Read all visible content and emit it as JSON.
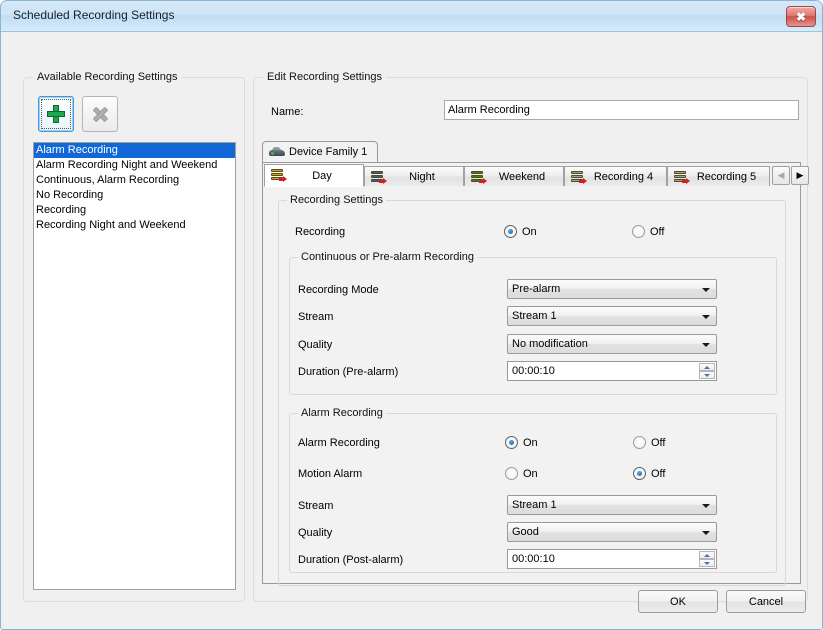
{
  "window": {
    "title": "Scheduled Recording Settings",
    "close_label": "✖"
  },
  "left_panel": {
    "title": "Available Recording Settings",
    "add_button": {
      "label": "",
      "icon": "plus-icon"
    },
    "delete_button": {
      "label": "",
      "icon": "x-icon"
    },
    "list": [
      {
        "label": "Alarm Recording",
        "selected": true
      },
      {
        "label": "Alarm Recording Night and Weekend",
        "selected": false
      },
      {
        "label": "Continuous, Alarm Recording",
        "selected": false
      },
      {
        "label": "No Recording",
        "selected": false
      },
      {
        "label": "Recording",
        "selected": false
      },
      {
        "label": "Recording Night and Weekend",
        "selected": false
      }
    ]
  },
  "right_panel": {
    "title": "Edit Recording Settings",
    "name_label": "Name:",
    "name_value": "Alarm Recording",
    "family_tab": {
      "label": "Device Family 1",
      "icon": "camera-icon"
    },
    "tabs": [
      {
        "label": "Day",
        "icon": "server-icon",
        "active": true,
        "icon_color": "#c9a227"
      },
      {
        "label": "Night",
        "icon": "server-icon",
        "active": false,
        "icon_color": "#2b5fa8"
      },
      {
        "label": "Weekend",
        "icon": "server-icon",
        "active": false,
        "icon_color": "#1f8a2f"
      },
      {
        "label": "Recording 4",
        "icon": "server-icon",
        "active": false,
        "icon_color": "#8fa3bd"
      },
      {
        "label": "Recording 5",
        "icon": "server-icon",
        "active": false,
        "icon_color": "#8fa3bd"
      }
    ],
    "tab_scroll": {
      "left": "◀",
      "right": "▶"
    },
    "recording_settings": {
      "title": "Recording Settings",
      "recording": {
        "label": "Recording",
        "on_label": "On",
        "off_label": "Off",
        "value": "On"
      },
      "continuous": {
        "title": "Continuous or Pre-alarm Recording",
        "recording_mode": {
          "label": "Recording Mode",
          "value": "Pre-alarm"
        },
        "stream": {
          "label": "Stream",
          "value": "Stream 1"
        },
        "quality": {
          "label": "Quality",
          "value": "No modification"
        },
        "duration": {
          "label": "Duration (Pre-alarm)",
          "value": "00:00:10"
        }
      },
      "alarm": {
        "title": "Alarm Recording",
        "alarm_recording": {
          "label": "Alarm Recording",
          "on_label": "On",
          "off_label": "Off",
          "value": "On"
        },
        "motion_alarm": {
          "label": "Motion Alarm",
          "on_label": "On",
          "off_label": "Off",
          "value": "Off"
        },
        "stream": {
          "label": "Stream",
          "value": "Stream 1"
        },
        "quality": {
          "label": "Quality",
          "value": "Good"
        },
        "duration": {
          "label": "Duration (Post-alarm)",
          "value": "00:00:10"
        }
      }
    }
  },
  "footer": {
    "ok_label": "OK",
    "cancel_label": "Cancel"
  },
  "colors": {
    "selection": "#1268d6",
    "titlebar": "#cfe4f5",
    "radio_dot": "#0b5fb0",
    "close_button": "#cf4e47"
  }
}
